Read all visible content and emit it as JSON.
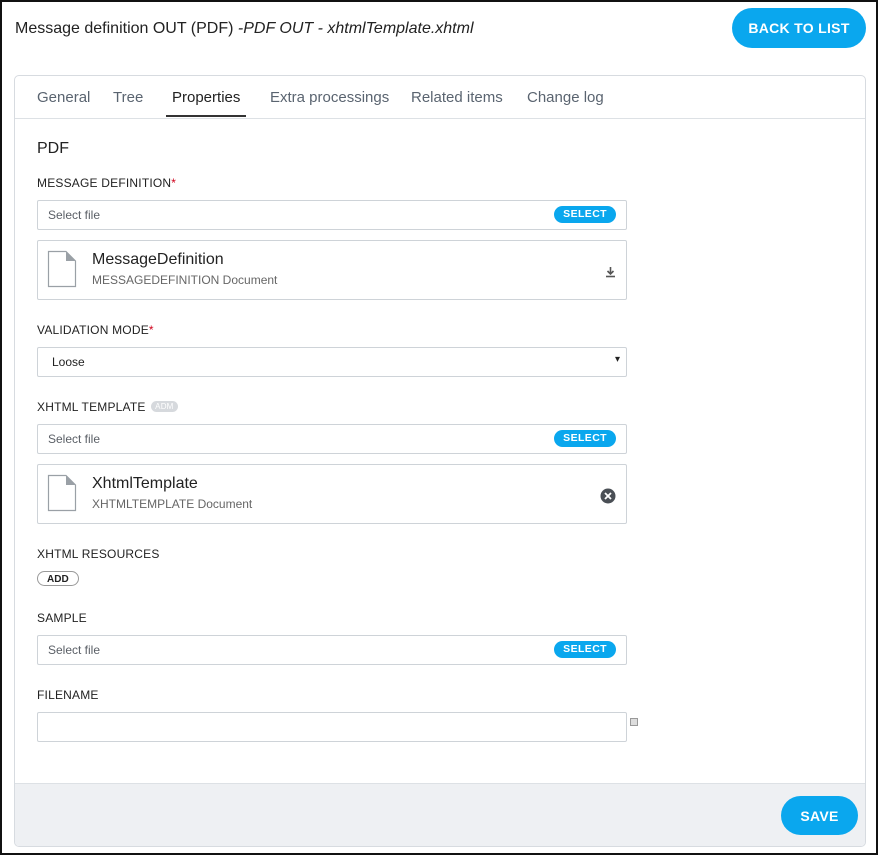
{
  "header": {
    "title": "Message definition OUT (PDF)",
    "subtitle": "-PDF OUT - xhtmlTemplate.xhtml",
    "back_label": "BACK TO LIST"
  },
  "tabs": [
    {
      "label": "General",
      "active": false
    },
    {
      "label": "Tree",
      "active": false
    },
    {
      "label": "Properties",
      "active": true
    },
    {
      "label": "Extra processings",
      "active": false
    },
    {
      "label": "Related items",
      "active": false
    },
    {
      "label": "Change log",
      "active": false
    }
  ],
  "section_title": "PDF",
  "message_definition": {
    "label": "MESSAGE DEFINITION",
    "required_mark": "*",
    "placeholder": "Select file",
    "select_label": "SELECT",
    "file": {
      "name": "MessageDefinition",
      "type": "MESSAGEDEFINITION Document",
      "action_icon": "download-icon"
    }
  },
  "validation_mode": {
    "label": "VALIDATION MODE",
    "required_mark": "*",
    "value": "Loose",
    "caret": "▾"
  },
  "xhtml_template": {
    "label": "XHTML TEMPLATE",
    "badge": "ADM",
    "placeholder": "Select file",
    "select_label": "SELECT",
    "file": {
      "name": "XhtmlTemplate",
      "type": "XHTMLTEMPLATE Document",
      "action_icon": "remove-icon"
    }
  },
  "xhtml_resources": {
    "label": "XHTML RESOURCES",
    "add_label": "ADD"
  },
  "sample": {
    "label": "SAMPLE",
    "placeholder": "Select file",
    "select_label": "SELECT"
  },
  "filename": {
    "label": "FILENAME",
    "value": ""
  },
  "footer": {
    "save_label": "SAVE"
  },
  "colors": {
    "accent": "#0aa7ee",
    "required": "#d0021b",
    "footer_bg": "#eef0f3"
  }
}
